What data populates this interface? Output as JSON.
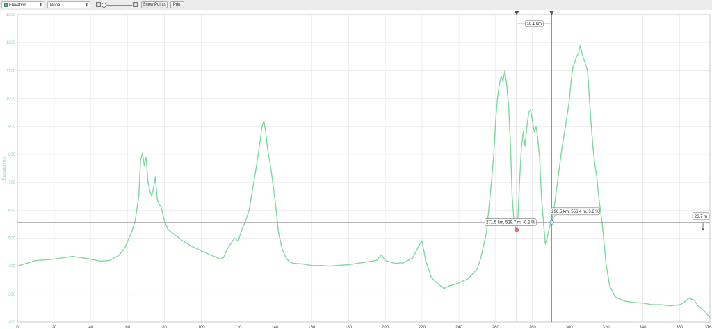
{
  "toolbar": {
    "profile_select": "Elevation",
    "overlay_select": "None",
    "show_points_label": "Show Points",
    "print_label": "Print"
  },
  "chart_data": {
    "type": "line",
    "title": "",
    "xlabel": "",
    "ylabel": "Elevation (m)",
    "xlim": [
      0,
      376.5
    ],
    "ylim": [
      200,
      1300
    ],
    "x_ticks": [
      "0",
      "20",
      "40",
      "60",
      "80",
      "100",
      "120",
      "140",
      "160",
      "180",
      "200",
      "220",
      "240",
      "260",
      "280",
      "300",
      "320",
      "340",
      "360",
      "376.5"
    ],
    "y_ticks": [
      "200",
      "300",
      "400",
      "500",
      "600",
      "700",
      "800",
      "900",
      "1000",
      "1100",
      "1200",
      "1300"
    ],
    "grid": true,
    "legend": "none",
    "line_color": "#7dd8a0",
    "series": [
      {
        "x": [
          0,
          10,
          20,
          30,
          40,
          45,
          50,
          55,
          58,
          60,
          62,
          64,
          66,
          67,
          68,
          69,
          70,
          71,
          72,
          73,
          74,
          75,
          76,
          77,
          78,
          80,
          82,
          85,
          90,
          95,
          100,
          105,
          108,
          110,
          112,
          114,
          116,
          118,
          120,
          122,
          124,
          126,
          128,
          130,
          132,
          133,
          134,
          135,
          136,
          138,
          140,
          142,
          144,
          146,
          148,
          150,
          155,
          160,
          165,
          170,
          175,
          180,
          185,
          190,
          195,
          198,
          200,
          205,
          210,
          215,
          218,
          220,
          222,
          225,
          228,
          230,
          232,
          235,
          238,
          240,
          245,
          250,
          252,
          255,
          257,
          259,
          260,
          261,
          262,
          263,
          264,
          265,
          266,
          267,
          268,
          269,
          270,
          271,
          271.5,
          272,
          273,
          274,
          275,
          276,
          277,
          278,
          279,
          280,
          281,
          282,
          283,
          284,
          285,
          286,
          287,
          288,
          289,
          290,
          290.5,
          292,
          294,
          296,
          298,
          300,
          301,
          302,
          303,
          304,
          305,
          306,
          307,
          308,
          309,
          310,
          311,
          312,
          313,
          314,
          315,
          316,
          318,
          320,
          322,
          325,
          330,
          335,
          340,
          345,
          350,
          355,
          360,
          362,
          365,
          368,
          370,
          372,
          374,
          376.5
        ],
        "y": [
          400,
          420,
          425,
          435,
          425,
          418,
          420,
          438,
          460,
          490,
          520,
          560,
          650,
          780,
          805,
          760,
          790,
          700,
          670,
          650,
          680,
          720,
          640,
          620,
          615,
          560,
          530,
          515,
          490,
          470,
          455,
          440,
          432,
          425,
          430,
          460,
          480,
          500,
          490,
          530,
          560,
          600,
          680,
          760,
          850,
          900,
          920,
          880,
          820,
          740,
          640,
          520,
          460,
          430,
          415,
          410,
          408,
          402,
          402,
          400,
          403,
          405,
          410,
          415,
          420,
          440,
          420,
          410,
          412,
          430,
          470,
          490,
          420,
          360,
          340,
          330,
          320,
          330,
          335,
          340,
          355,
          390,
          430,
          520,
          650,
          800,
          920,
          1000,
          1050,
          1080,
          1060,
          1100,
          1050,
          980,
          850,
          650,
          560,
          530,
          529.7,
          560,
          700,
          820,
          880,
          830,
          900,
          950,
          960,
          920,
          880,
          900,
          850,
          780,
          640,
          560,
          480,
          500,
          530,
          560,
          556.4,
          620,
          720,
          820,
          900,
          990,
          1060,
          1110,
          1130,
          1150,
          1160,
          1190,
          1160,
          1140,
          1120,
          1100,
          1000,
          900,
          820,
          760,
          720,
          650,
          550,
          410,
          330,
          290,
          275,
          270,
          268,
          262,
          262,
          258,
          262,
          268,
          285,
          278,
          258,
          248,
          236,
          215
        ]
      }
    ],
    "markers": [
      {
        "label": "271.5 km, 529.7 m, -0.2 %",
        "x": 271.5,
        "y": 529.7,
        "color": "#ff6d6d"
      },
      {
        "label": "290.5 km, 556.4 m, 3.6 %",
        "x": 290.5,
        "y": 556.4,
        "color": "#5b8df0"
      }
    ],
    "span_label": "19.1 km",
    "elevation_diff_label": "26.7 m"
  }
}
